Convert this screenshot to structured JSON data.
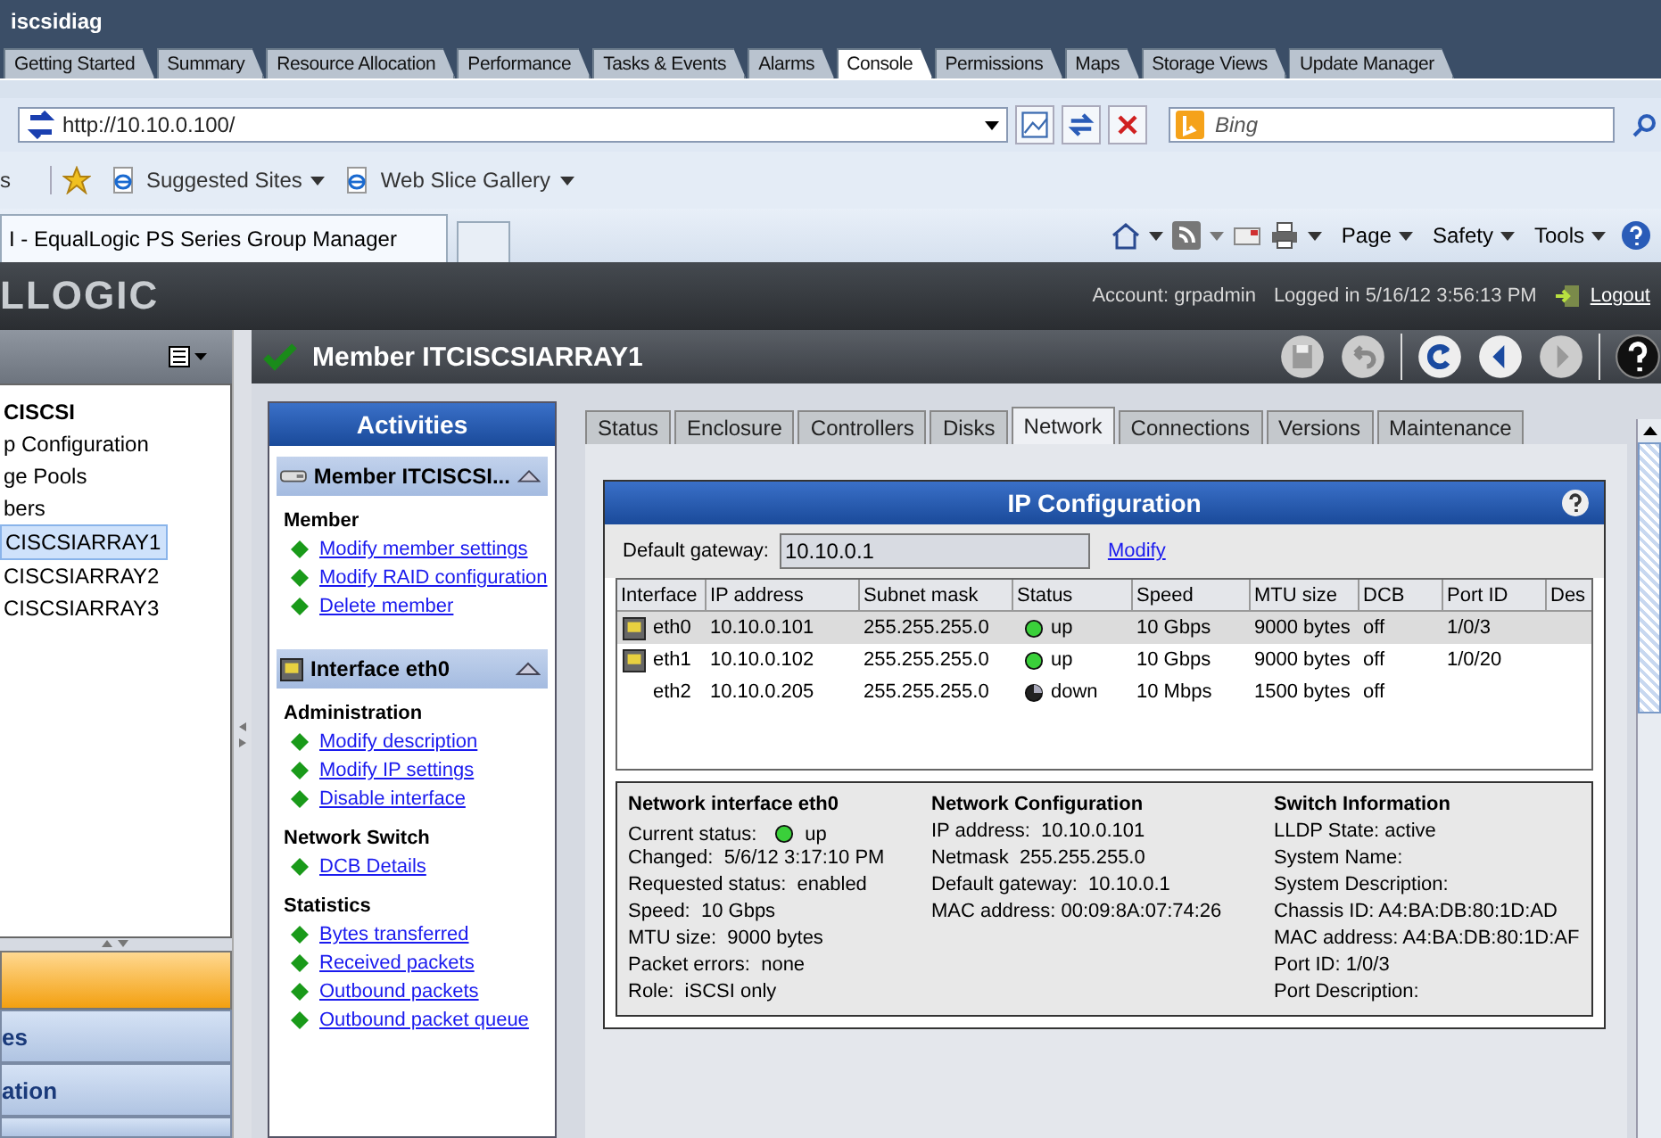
{
  "window": {
    "title": "iscsidiag"
  },
  "app_tabs": [
    {
      "label": "Getting Started",
      "selected": false
    },
    {
      "label": "Summary",
      "selected": false
    },
    {
      "label": "Resource Allocation",
      "selected": false
    },
    {
      "label": "Performance",
      "selected": false
    },
    {
      "label": "Tasks & Events",
      "selected": false
    },
    {
      "label": "Alarms",
      "selected": false
    },
    {
      "label": "Console",
      "selected": true
    },
    {
      "label": "Permissions",
      "selected": false
    },
    {
      "label": "Maps",
      "selected": false
    },
    {
      "label": "Storage Views",
      "selected": false
    },
    {
      "label": "Update Manager",
      "selected": false
    }
  ],
  "address_bar": {
    "url": "http://10.10.0.100/",
    "search_placeholder": "Bing"
  },
  "favorites_bar": {
    "cut_label": "s",
    "items": [
      "Suggested Sites",
      "Web Slice Gallery"
    ]
  },
  "browser_tab": {
    "title": "I - EqualLogic PS Series Group Manager"
  },
  "command_bar": [
    "Page",
    "Safety",
    "Tools"
  ],
  "header": {
    "logo": "LLOGIC",
    "account": "Account: grpadmin",
    "login": "Logged in 5/16/12 3:56:13 PM",
    "logout": "Logout"
  },
  "tree": [
    {
      "label": "CISCSI",
      "bold": true,
      "selected": false
    },
    {
      "label": "p Configuration",
      "bold": false,
      "selected": false
    },
    {
      "label": "ge Pools",
      "bold": false,
      "selected": false
    },
    {
      "label": "bers",
      "bold": false,
      "selected": false
    },
    {
      "label": "CISCSIARRAY1",
      "bold": false,
      "selected": true
    },
    {
      "label": "CISCSIARRAY2",
      "bold": false,
      "selected": false
    },
    {
      "label": "CISCSIARRAY3",
      "bold": false,
      "selected": false
    }
  ],
  "nav_buttons": [
    {
      "label": "es"
    },
    {
      "label": "ation"
    }
  ],
  "member": {
    "title": "Member ITCISCSIARRAY1"
  },
  "activities": {
    "title": "Activities",
    "sections": [
      {
        "kind": "member",
        "header": "Member ITCISCSI...",
        "groups": [
          {
            "title": "Member",
            "links": [
              "Modify member settings",
              "Modify RAID configuration",
              "Delete member"
            ]
          }
        ]
      },
      {
        "kind": "interface",
        "header": "Interface eth0",
        "groups": [
          {
            "title": "Administration",
            "links": [
              "Modify description",
              "Modify IP settings",
              "Disable interface"
            ]
          },
          {
            "title": "Network Switch",
            "links": [
              "DCB Details"
            ]
          },
          {
            "title": "Statistics",
            "links": [
              "Bytes transferred",
              "Received packets",
              "Outbound packets",
              "Outbound packet queue"
            ]
          }
        ]
      }
    ]
  },
  "detail_tabs": [
    {
      "label": "Status",
      "selected": false
    },
    {
      "label": "Enclosure",
      "selected": false
    },
    {
      "label": "Controllers",
      "selected": false
    },
    {
      "label": "Disks",
      "selected": false
    },
    {
      "label": "Network",
      "selected": true
    },
    {
      "label": "Connections",
      "selected": false
    },
    {
      "label": "Versions",
      "selected": false
    },
    {
      "label": "Maintenance",
      "selected": false
    }
  ],
  "ip_config": {
    "title": "IP Configuration",
    "gateway_label": "Default gateway:",
    "gateway": "10.10.0.1",
    "modify": "Modify",
    "columns": [
      "Interface",
      "IP address",
      "Subnet mask",
      "Status",
      "Speed",
      "MTU size",
      "DCB",
      "Port ID",
      "Des"
    ],
    "rows": [
      {
        "port_icon": true,
        "interface": "eth0",
        "ip": "10.10.0.101",
        "mask": "255.255.255.0",
        "up": true,
        "status": "up",
        "speed": "10 Gbps",
        "mtu": "9000 bytes",
        "dcb": "off",
        "port_id": "1/0/3",
        "selected": true
      },
      {
        "port_icon": true,
        "interface": "eth1",
        "ip": "10.10.0.102",
        "mask": "255.255.255.0",
        "up": true,
        "status": "up",
        "speed": "10 Gbps",
        "mtu": "9000 bytes",
        "dcb": "off",
        "port_id": "1/0/20",
        "selected": false
      },
      {
        "port_icon": false,
        "interface": "eth2",
        "ip": "10.10.0.205",
        "mask": "255.255.255.0",
        "up": false,
        "status": "down",
        "speed": "10 Mbps",
        "mtu": "1500 bytes",
        "dcb": "off",
        "selected": false
      }
    ]
  },
  "details": {
    "interface": {
      "title": "Network interface eth0",
      "status_label": "Current status:",
      "status": "up",
      "up": true,
      "lines": [
        "Changed:  5/6/12 3:17:10 PM",
        "Requested status:  enabled",
        "Speed:  10 Gbps",
        "MTU size:  9000 bytes",
        "Packet errors:  none",
        "Role:  iSCSI only"
      ]
    },
    "network": {
      "title": "Network Configuration",
      "lines": [
        "IP address:  10.10.0.101",
        "Netmask  255.255.255.0",
        "Default gateway:  10.10.0.1",
        "MAC address: 00:09:8A:07:74:26"
      ]
    },
    "switch": {
      "title": "Switch Information",
      "lines": [
        "LLDP State: active",
        "System Name:",
        "System Description:",
        "Chassis ID: A4:BA:DB:80:1D:AD",
        "MAC address: A4:BA:DB:80:1D:AF",
        "Port ID: 1/0/3",
        "Port Description:"
      ]
    }
  }
}
